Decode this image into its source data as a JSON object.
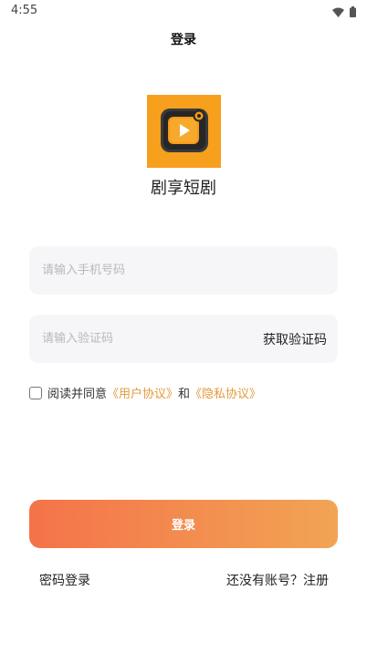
{
  "status_bar": {
    "time": "4:55"
  },
  "header": {
    "title": "登录"
  },
  "app": {
    "name": "剧享短剧",
    "logo_icon": "tv-play-icon",
    "brand_color": "#f6a01e"
  },
  "form": {
    "phone_placeholder": "请输入手机号码",
    "phone_value": "",
    "code_placeholder": "请输入验证码",
    "code_value": "",
    "get_code_label": "获取验证码"
  },
  "agreement": {
    "checked": false,
    "prefix": "阅读并同意",
    "user_agreement": "《用户协议》",
    "joiner": "和",
    "privacy_agreement": "《隐私协议》",
    "link_color": "#e39a3b"
  },
  "actions": {
    "login_label": "登录",
    "password_login_label": "密码登录",
    "register_prompt": "还没有账号？",
    "register_label": "注册"
  },
  "colors": {
    "button_gradient_start": "#f4734a",
    "button_gradient_end": "#f2a454"
  }
}
